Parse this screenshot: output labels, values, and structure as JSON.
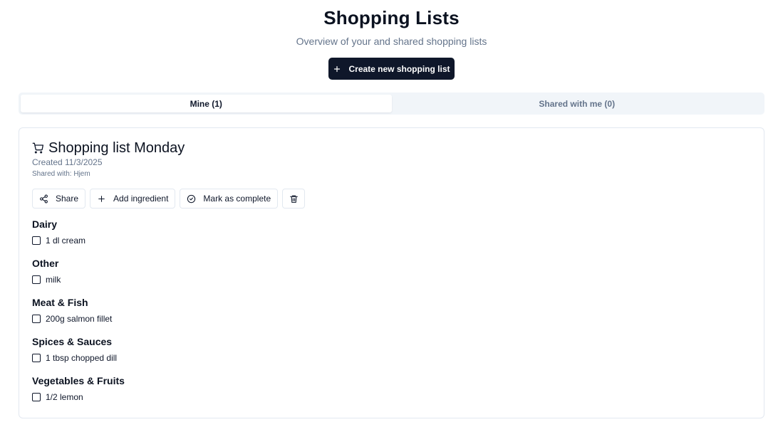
{
  "header": {
    "title": "Shopping Lists",
    "subtitle": "Overview of your and shared shopping lists"
  },
  "create_button": {
    "label": "Create new shopping list",
    "icon": "plus-icon"
  },
  "tabs": [
    {
      "label": "Mine (1)",
      "active": true
    },
    {
      "label": "Shared with me (0)",
      "active": false
    }
  ],
  "list": {
    "icon": "shopping-cart-icon",
    "title": "Shopping list Monday",
    "created": "Created 11/3/2025",
    "shared_with": "Shared with: Hjem",
    "actions": {
      "share": {
        "label": "Share",
        "icon": "share-icon"
      },
      "add": {
        "label": "Add ingredient",
        "icon": "plus-icon"
      },
      "complete": {
        "label": "Mark as complete",
        "icon": "circle-check-icon"
      },
      "delete": {
        "icon": "trash-icon"
      }
    },
    "groups": [
      {
        "name": "Dairy",
        "items": [
          {
            "label": "1 dl cream",
            "checked": false
          }
        ]
      },
      {
        "name": "Other",
        "items": [
          {
            "label": "milk",
            "checked": false
          }
        ]
      },
      {
        "name": "Meat & Fish",
        "items": [
          {
            "label": "200g salmon fillet",
            "checked": false
          }
        ]
      },
      {
        "name": "Spices & Sauces",
        "items": [
          {
            "label": "1 tbsp chopped dill",
            "checked": false
          }
        ]
      },
      {
        "name": "Vegetables & Fruits",
        "items": [
          {
            "label": "1/2 lemon",
            "checked": false
          }
        ]
      }
    ]
  },
  "colors": {
    "primary": "#0f172a",
    "muted_text": "#64748b",
    "border": "#e2e8f0",
    "tab_bg": "#f1f5f9"
  }
}
